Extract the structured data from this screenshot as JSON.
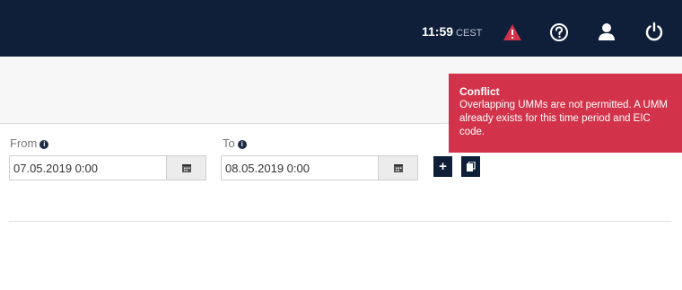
{
  "header": {
    "time": "11:59",
    "timezone": "CEST"
  },
  "icons": [
    "warning-icon",
    "help-icon",
    "user-icon",
    "power-icon",
    "info-icon",
    "calendar-icon",
    "plus-icon",
    "copy-icon"
  ],
  "colors": {
    "header_bg": "#0f1f3a",
    "alert_red": "#d2334a"
  },
  "form": {
    "from": {
      "label": "From",
      "value": "07.05.2019 0:00"
    },
    "to": {
      "label": "To",
      "value": "08.05.2019 0:00"
    },
    "add_label": "+"
  },
  "toast": {
    "title": "Conflict",
    "message": "Overlapping UMMs are not permitted. A UMM already exists for this time period and EIC code."
  }
}
